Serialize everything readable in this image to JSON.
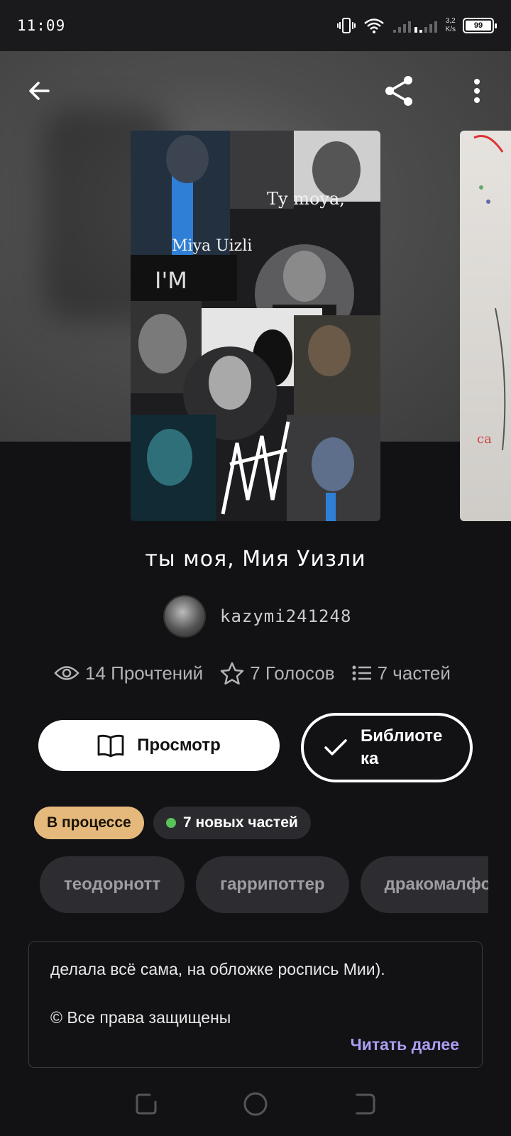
{
  "status_bar": {
    "time": "11:09",
    "speed_value": "3,2",
    "speed_unit": "K/s",
    "battery": "99"
  },
  "story": {
    "title": "ты моя, Мия Уизли",
    "author": "kazymi241248",
    "cover_texts": [
      "Ty moya,",
      "Miya Uizli",
      "I'M"
    ]
  },
  "stats": {
    "reads": "14 Прочтений",
    "votes": "7 Голосов",
    "parts": "7 частей"
  },
  "actions": {
    "read_label": "Просмотр",
    "library_line1": "Библиоте",
    "library_line2": "ка"
  },
  "badges": {
    "status": "В процессе",
    "new_parts": "7 новых частей",
    "new_dot_color": "#58c35a"
  },
  "tags": [
    "теодорнотт",
    "гаррипоттер",
    "дракомалфой"
  ],
  "description": {
    "line1": "делала всё сама, на обложке роспись Мии).",
    "line2": "© Все права защищены",
    "read_more": "Читать далее"
  },
  "icons": [
    "back-arrow-icon",
    "share-icon",
    "more-vertical-icon",
    "eye-icon",
    "star-icon",
    "list-icon",
    "book-icon",
    "check-icon"
  ]
}
